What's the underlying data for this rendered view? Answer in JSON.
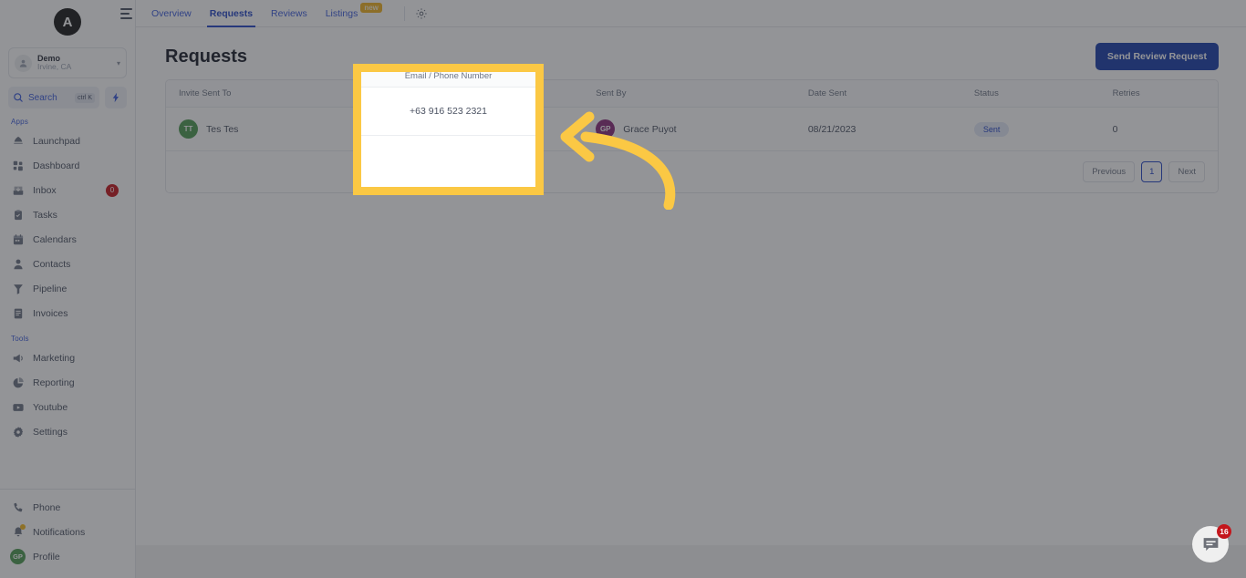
{
  "brand": {
    "logo_letter": "A"
  },
  "location_switcher": {
    "name": "Demo",
    "sub": "Irvine, CA",
    "chevron": "chevron-down-icon"
  },
  "search": {
    "label": "Search",
    "shortcut": "ctrl K"
  },
  "sidebar": {
    "sections": [
      {
        "label": "Apps",
        "items": [
          {
            "label": "Launchpad",
            "icon": "rocket-icon",
            "badge": ""
          },
          {
            "label": "Dashboard",
            "icon": "grid-icon",
            "badge": ""
          },
          {
            "label": "Inbox",
            "icon": "inbox-icon",
            "badge": "0"
          },
          {
            "label": "Tasks",
            "icon": "clipboard-icon",
            "badge": ""
          },
          {
            "label": "Calendars",
            "icon": "calendar-icon",
            "badge": ""
          },
          {
            "label": "Contacts",
            "icon": "person-icon",
            "badge": ""
          },
          {
            "label": "Pipeline",
            "icon": "funnel-icon",
            "badge": ""
          },
          {
            "label": "Invoices",
            "icon": "invoice-icon",
            "badge": ""
          }
        ]
      },
      {
        "label": "Tools",
        "items": [
          {
            "label": "Marketing",
            "icon": "megaphone-icon",
            "badge": ""
          },
          {
            "label": "Reporting",
            "icon": "pie-chart-icon",
            "badge": ""
          },
          {
            "label": "Youtube",
            "icon": "video-icon",
            "badge": ""
          },
          {
            "label": "Settings",
            "icon": "gear-icon",
            "badge": ""
          }
        ]
      }
    ],
    "bottom_items": [
      {
        "label": "Phone",
        "icon": "phone-icon"
      },
      {
        "label": "Notifications",
        "icon": "bell-icon"
      },
      {
        "label": "Profile",
        "icon": "avatar-icon",
        "initials": "GP"
      }
    ]
  },
  "topbar": {
    "hamburger": "hamburger-icon",
    "gear": "gear-icon",
    "tabs": [
      {
        "label": "Overview",
        "active": false,
        "badge": ""
      },
      {
        "label": "Requests",
        "active": true,
        "badge": ""
      },
      {
        "label": "Reviews",
        "active": false,
        "badge": ""
      },
      {
        "label": "Listings",
        "active": false,
        "badge": "new"
      }
    ]
  },
  "page": {
    "title": "Requests",
    "primary_button": "Send Review Request"
  },
  "table": {
    "headers": [
      "Invite Sent To",
      "Email / Phone Number",
      "Sent By",
      "Date Sent",
      "Status",
      "Retries"
    ],
    "rows": [
      {
        "invite_sent_to": "Tes Tes",
        "invite_initials": "TT",
        "email_phone": "+63 916 523 2321",
        "sent_by": "Grace Puyot",
        "sent_by_initials": "GP",
        "date_sent": "08/21/2023",
        "status": "Sent",
        "retries": "0"
      }
    ]
  },
  "pagination": {
    "previous": "Previous",
    "current_page": "1",
    "next": "Next"
  },
  "highlight": {
    "column_header": "Email / Phone Number",
    "column_value": "+63 916 523 2321",
    "border_color": "#fbc844",
    "arrow": "curved-arrow-left-icon"
  },
  "chat_widget": {
    "icon": "chat-bubble-icon",
    "unread": "16"
  },
  "colors": {
    "accent_blue": "#2546c7",
    "primary_button": "#1b3faa",
    "highlight_yellow": "#fbc844",
    "badge_red": "#c4161c",
    "new_badge": "#f0b323",
    "avatar_green": "#4f9b52",
    "avatar_purple": "#8a2c7a"
  }
}
